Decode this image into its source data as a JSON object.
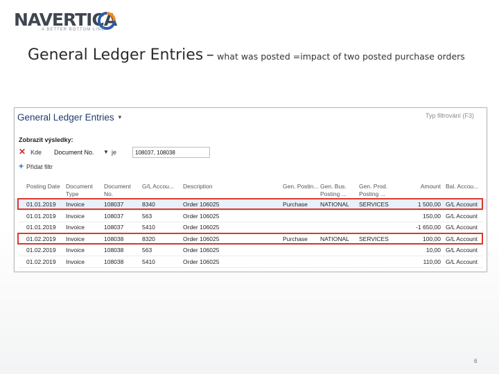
{
  "logo": {
    "name": "NAVERTICA",
    "tagline": "A BETTER BOTTOM LINE"
  },
  "title": {
    "main": "General Ledger Entries",
    "dash": "–",
    "subtitle": "what was posted =impact of two posted purchase orders"
  },
  "nav": {
    "page_title": "General Ledger Entries",
    "filter_type": "Typ filtrování (F3)",
    "show_results_label": "Zobrazit výsledky:",
    "filter": {
      "where_label": "Kde",
      "field": "Document No.",
      "operator": "je",
      "value": "108037, 108038"
    },
    "add_filter_label": "Přidat filtr",
    "columns": [
      {
        "key": "date",
        "label": "Posting Date"
      },
      {
        "key": "doc_type",
        "label": "Document Type"
      },
      {
        "key": "doc_no",
        "label": "Document No."
      },
      {
        "key": "gl_account",
        "label": "G/L Accou..."
      },
      {
        "key": "description",
        "label": "Description"
      },
      {
        "key": "gen_posting",
        "label": "Gen. Postin..."
      },
      {
        "key": "gen_bus",
        "label": "Gen. Bus. Posting ..."
      },
      {
        "key": "gen_prod",
        "label": "Gen. Prod. Posting ..."
      },
      {
        "key": "amount",
        "label": "Amount"
      },
      {
        "key": "bal_account",
        "label": "Bal. Accou..."
      }
    ],
    "rows": [
      {
        "date": "01.01.2019",
        "doc_type": "Invoice",
        "doc_no": "108037",
        "gl_account": "8340",
        "description": "Order 106025",
        "gen_posting": "Purchase",
        "gen_bus": "NATIONAL",
        "gen_prod": "SERVICES",
        "amount": "1 500,00",
        "bal_account": "G/L Account",
        "selected": true,
        "highlighted": true
      },
      {
        "date": "01.01.2019",
        "doc_type": "Invoice",
        "doc_no": "108037",
        "gl_account": "563",
        "description": "Order 106025",
        "gen_posting": "",
        "gen_bus": "",
        "gen_prod": "",
        "amount": "150,00",
        "bal_account": "G/L Account"
      },
      {
        "date": "01.01.2019",
        "doc_type": "Invoice",
        "doc_no": "108037",
        "gl_account": "5410",
        "description": "Order 106025",
        "gen_posting": "",
        "gen_bus": "",
        "gen_prod": "",
        "amount": "-1 650,00",
        "bal_account": "G/L Account"
      },
      {
        "date": "01.02.2019",
        "doc_type": "Invoice",
        "doc_no": "108038",
        "gl_account": "8320",
        "description": "Order 106025",
        "gen_posting": "Purchase",
        "gen_bus": "NATIONAL",
        "gen_prod": "SERVICES",
        "amount": "100,00",
        "bal_account": "G/L Account",
        "highlighted": true
      },
      {
        "date": "01.02.2019",
        "doc_type": "Invoice",
        "doc_no": "108038",
        "gl_account": "563",
        "description": "Order 106025",
        "gen_posting": "",
        "gen_bus": "",
        "gen_prod": "",
        "amount": "10,00",
        "bal_account": "G/L Account"
      },
      {
        "date": "01.02.2019",
        "doc_type": "Invoice",
        "doc_no": "108038",
        "gl_account": "5410",
        "description": "Order 106025",
        "gen_posting": "",
        "gen_bus": "",
        "gen_prod": "",
        "amount": "110,00",
        "bal_account": "G/L Account"
      }
    ]
  },
  "page_number": "6",
  "colors": {
    "highlight": "#d9392f",
    "selected_row": "#e9f0f9",
    "title_blue": "#1f3b6d",
    "logo_orange": "#f08a1c",
    "logo_blue": "#2a5da8"
  }
}
